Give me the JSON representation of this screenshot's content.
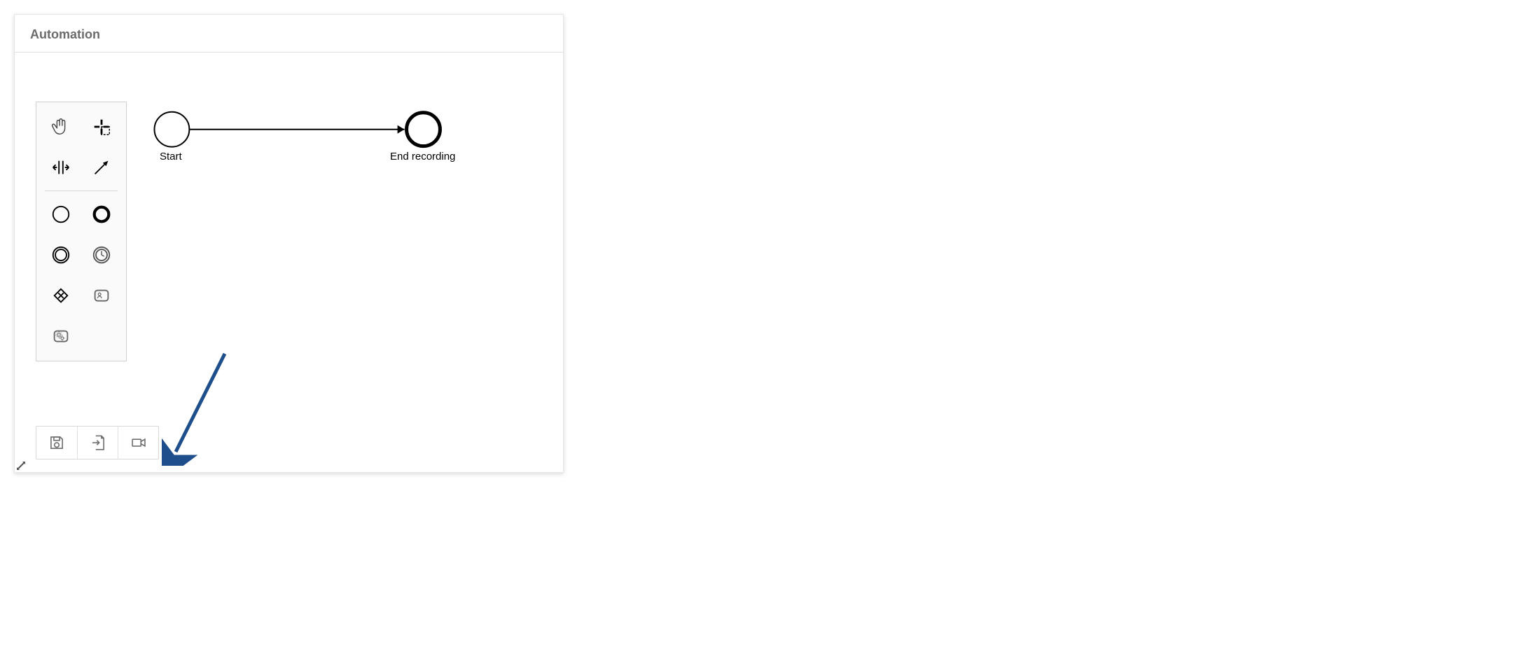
{
  "panel": {
    "title": "Automation"
  },
  "diagram": {
    "start_label": "Start",
    "end_label": "End recording"
  },
  "tools": {
    "hand": "hand-tool",
    "lasso": "lasso-tool",
    "space": "space-tool",
    "connect": "connect-tool",
    "start_event": "start-event",
    "end_event": "end-event",
    "intermediate_event": "intermediate-event",
    "timer_event": "timer-event",
    "gateway": "gateway",
    "user_task": "user-task",
    "service_task": "service-task"
  },
  "bottombar": {
    "save": "save",
    "import": "import",
    "record": "record"
  },
  "annotation": {
    "color": "#1e4e8c"
  }
}
